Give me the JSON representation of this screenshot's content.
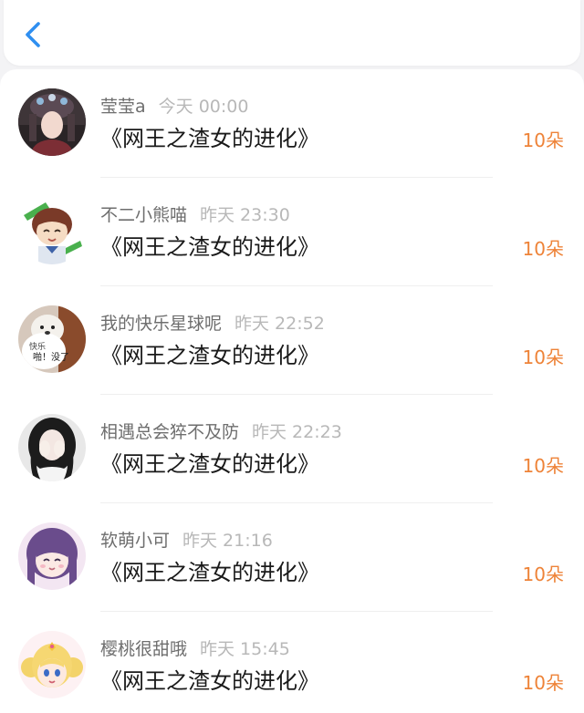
{
  "header": {
    "back_icon": "chevron-left-icon"
  },
  "colors": {
    "accent": "#2f8ff0",
    "count": "#ee8338"
  },
  "rows": [
    {
      "user": "莹莹a",
      "time": "今天 00:00",
      "book": "《网王之渣女的进化》",
      "count": "10朵"
    },
    {
      "user": "不二小熊喵",
      "time": "昨天 23:30",
      "book": "《网王之渣女的进化》",
      "count": "10朵"
    },
    {
      "user": "我的快乐星球呢",
      "time": "昨天 22:52",
      "book": "《网王之渣女的进化》",
      "count": "10朵"
    },
    {
      "user": "相遇总会猝不及防",
      "time": "昨天 22:23",
      "book": "《网王之渣女的进化》",
      "count": "10朵"
    },
    {
      "user": "软萌小可",
      "time": "昨天 21:16",
      "book": "《网王之渣女的进化》",
      "count": "10朵"
    },
    {
      "user": "樱桃很甜哦",
      "time": "昨天 15:45",
      "book": "《网王之渣女的进化》",
      "count": "10朵"
    }
  ],
  "avatar_text": {
    "dog_line1": "快乐",
    "dog_line2": "啪！没了"
  }
}
